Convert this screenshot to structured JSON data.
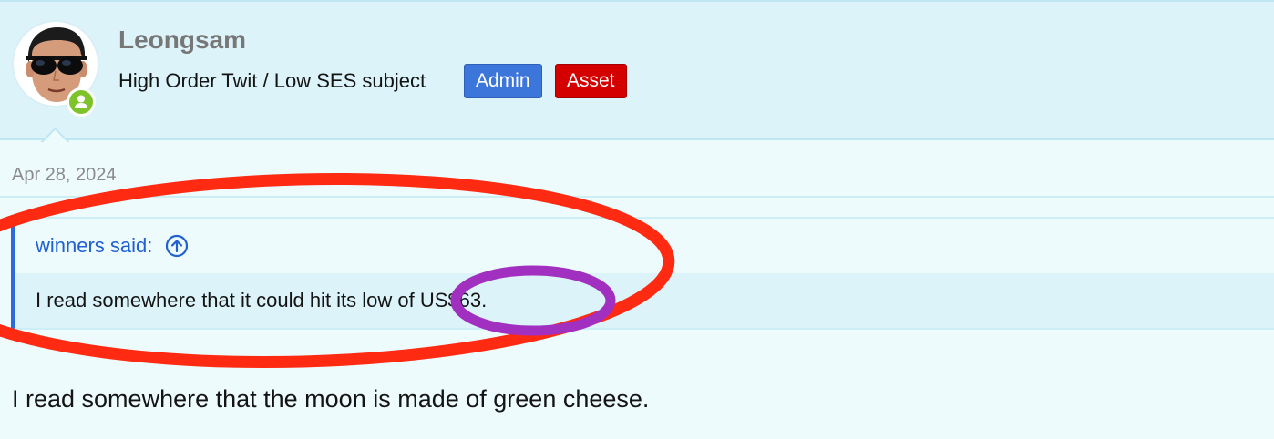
{
  "user": {
    "name": "Leongsam",
    "title": "High Order Twit / Low SES subject",
    "badges": {
      "admin": "Admin",
      "asset": "Asset"
    }
  },
  "post": {
    "date": "Apr 28, 2024",
    "quote": {
      "author": "winners said:",
      "text": "I read somewhere that it could hit its low of US$63."
    },
    "message": "I read somewhere that the moon is made of green cheese."
  },
  "colors": {
    "annotation_red": "#ff2a12",
    "annotation_purple": "#a12fc0",
    "link_blue": "#2060d0",
    "online_green": "#7ec32b"
  },
  "icons": {
    "avatar": "user-avatar-photo",
    "online": "online-status-icon",
    "jump": "arrow-up-circle-icon"
  }
}
